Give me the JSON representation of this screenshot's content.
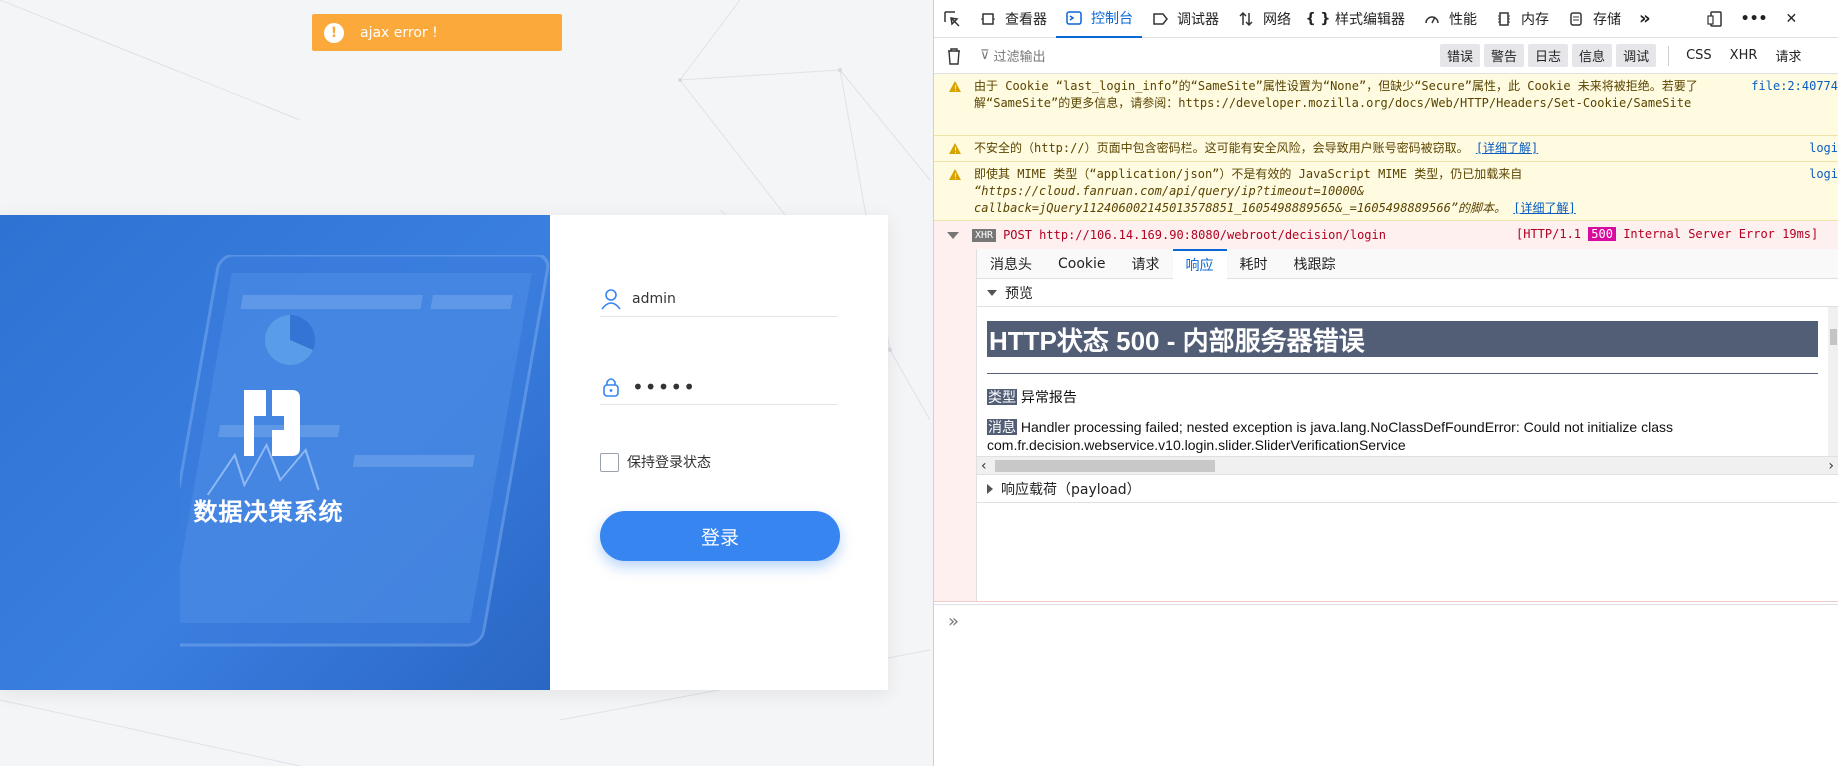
{
  "toast": {
    "icon": "exclamation-icon",
    "text": "ajax error !"
  },
  "brand": {
    "name": "数据决策系统",
    "logo": "fanruan-logo-icon"
  },
  "login": {
    "username_value": "admin",
    "password_value": "•••••",
    "remember_label": "保持登录状态",
    "login_label": "登录"
  },
  "devtools": {
    "tabs": [
      {
        "label": "查看器",
        "icon": "inspector-icon"
      },
      {
        "label": "控制台",
        "icon": "console-icon"
      },
      {
        "label": "调试器",
        "icon": "debugger-icon"
      },
      {
        "label": "网络",
        "icon": "network-icon"
      },
      {
        "label": "样式编辑器",
        "icon": "style-editor-icon"
      },
      {
        "label": "性能",
        "icon": "performance-icon"
      },
      {
        "label": "内存",
        "icon": "memory-icon"
      },
      {
        "label": "存储",
        "icon": "storage-icon"
      }
    ],
    "filter_placeholder": "过滤输出",
    "filters": [
      "错误",
      "警告",
      "日志",
      "信息",
      "调试"
    ],
    "filters_plain": [
      "CSS",
      "XHR",
      "请求"
    ],
    "messages": [
      {
        "text": "由于 Cookie “last_login_info”的“SameSite”属性设置为“None”，但缺少“Secure”属性，此 Cookie 未来将被拒绝。若要了解“SameSite”的更多信息，请参阅：https://developer.mozilla.org/docs/Web/HTTP/Headers/Set-Cookie/SameSite",
        "source": "file:2:40774"
      },
      {
        "text": "不安全的（http://）页面中包含密码栏。这可能有安全风险，会导致用户账号密码被窃取。",
        "link": "[详细了解]",
        "source": "logi"
      },
      {
        "text_a": "即使其 MIME 类型（“application/json”）不是有效的 JavaScript MIME 类型，仍已加载来自",
        "text_b": "“https://cloud.fanruan.com/api/query/ip?timeout=10000&",
        "text_c": "callback=jQuery112406002145013578851_1605498889565&_=1605498889566”的脚本。",
        "link": "[详细了解]",
        "source": "logi"
      }
    ],
    "xhr": {
      "tag": "XHR",
      "request": "POST http://106.14.169.90:8080/webroot/decision/login",
      "proto": "[HTTP/1.1",
      "code": "500",
      "status_text": "Internal Server Error 19ms]",
      "tabs": [
        "消息头",
        "Cookie",
        "请求",
        "响应",
        "耗时",
        "栈跟踪"
      ],
      "preview_label": "预览",
      "payload_label": "响应载荷（payload）",
      "preview": {
        "title": "HTTP状态 500 - 内部服务器错误",
        "type_label": "类型",
        "type_value": "异常报告",
        "message_label": "消息",
        "message_value": "Handler processing failed; nested exception is java.lang.NoClassDefFoundError: Could not initialize class com.fr.decision.webservice.v10.login.slider.SliderVerificationService"
      }
    },
    "console_prompt": "»"
  }
}
